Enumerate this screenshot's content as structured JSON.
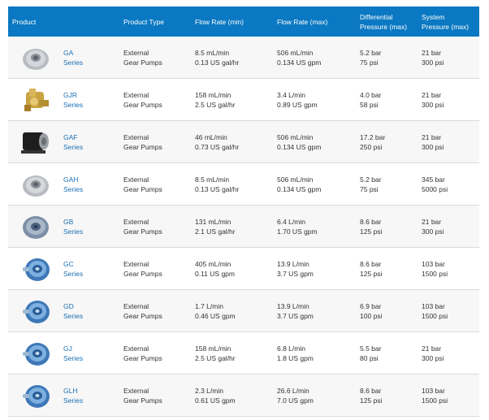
{
  "header": {
    "product": "Product",
    "product_type": "Product Type",
    "flow_min": "Flow Rate (min)",
    "flow_max": "Flow Rate (max)",
    "diff_pressure_1": "Differential",
    "diff_pressure_2": "Pressure (max)",
    "sys_pressure_1": "System",
    "sys_pressure_2": "Pressure (max)"
  },
  "colors": {
    "header_bg": "#0a78c2",
    "link": "#1a6fb5"
  },
  "rows": [
    {
      "image": "pump-silver-icon",
      "name": "GA",
      "series": "Series",
      "type1": "External",
      "type2": "Gear Pumps",
      "fmin1": "8.5 mL/min",
      "fmin2": "0.13 US gal/hr",
      "fmax1": "506 mL/min",
      "fmax2": "0.134 US gpm",
      "dp1": "5.2 bar",
      "dp2": "75 psi",
      "sp1": "21 bar",
      "sp2": "300 psi"
    },
    {
      "image": "pump-brass-icon",
      "name": "GJR",
      "series": "Series",
      "type1": "External",
      "type2": "Gear Pumps",
      "fmin1": "158 mL/min",
      "fmin2": "2.5 US gal/hr",
      "fmax1": "3.4 L/min",
      "fmax2": "0.89 US gpm",
      "dp1": "4.0 bar",
      "dp2": "58 psi",
      "sp1": "21 bar",
      "sp2": "300 psi"
    },
    {
      "image": "pump-black-icon",
      "name": "GAF",
      "series": "Series",
      "type1": "External",
      "type2": "Gear Pumps",
      "fmin1": "46 mL/min",
      "fmin2": "0.73 US gal/hr",
      "fmax1": "506 mL/min",
      "fmax2": "0.134 US gpm",
      "dp1": "17.2 bar",
      "dp2": "250 psi",
      "sp1": "21 bar",
      "sp2": "300 psi"
    },
    {
      "image": "pump-silver-icon",
      "name": "GAH",
      "series": "Series",
      "type1": "External",
      "type2": "Gear Pumps",
      "fmin1": "8.5 mL/min",
      "fmin2": "0.13 US gal/hr",
      "fmax1": "506 mL/min",
      "fmax2": "0.134 US gpm",
      "dp1": "5.2 bar",
      "dp2": "75 psi",
      "sp1": "345 bar",
      "sp2": "5000 psi"
    },
    {
      "image": "pump-blue-grey-icon",
      "name": "GB",
      "series": "Series",
      "type1": "External",
      "type2": "Gear Pumps",
      "fmin1": "131 mL/min",
      "fmin2": "2.1 US gal/hr",
      "fmax1": "6.4 L/min",
      "fmax2": "1.70 US gpm",
      "dp1": "8.6 bar",
      "dp2": "125 psi",
      "sp1": "21 bar",
      "sp2": "300 psi"
    },
    {
      "image": "pump-blue-icon",
      "name": "GC",
      "series": "Series",
      "type1": "External",
      "type2": "Gear Pumps",
      "fmin1": "405 mL/min",
      "fmin2": "0.11 US gpm",
      "fmax1": "13.9 L/min",
      "fmax2": "3.7 US gpm",
      "dp1": "8.6 bar",
      "dp2": "125 psi",
      "sp1": "103 bar",
      "sp2": "1500 psi"
    },
    {
      "image": "pump-blue-icon",
      "name": "GD",
      "series": "Series",
      "type1": "External",
      "type2": "Gear Pumps",
      "fmin1": "1.7 L/min",
      "fmin2": "0.46 US gpm",
      "fmax1": "13.9 L/min",
      "fmax2": "3.7 US gpm",
      "dp1": "6.9 bar",
      "dp2": "100 psi",
      "sp1": "103 bar",
      "sp2": "1500 psi"
    },
    {
      "image": "pump-blue-icon",
      "name": "GJ",
      "series": "Series",
      "type1": "External",
      "type2": "Gear Pumps",
      "fmin1": "158 mL/min",
      "fmin2": "2.5 US gal/hr",
      "fmax1": "6.8 L/min",
      "fmax2": "1.8 US gpm",
      "dp1": "5.5 bar",
      "dp2": "80 psi",
      "sp1": "21 bar",
      "sp2": "300 psi"
    },
    {
      "image": "pump-blue-icon",
      "name": "GLH",
      "series": "Series",
      "type1": "External",
      "type2": "Gear Pumps",
      "fmin1": "2.3 L/min",
      "fmin2": "0.61 US gpm",
      "fmax1": "26.6 L/min",
      "fmax2": "7.0 US gpm",
      "dp1": "8.6 bar",
      "dp2": "125 psi",
      "sp1": "103 bar",
      "sp2": "1500 psi"
    }
  ]
}
